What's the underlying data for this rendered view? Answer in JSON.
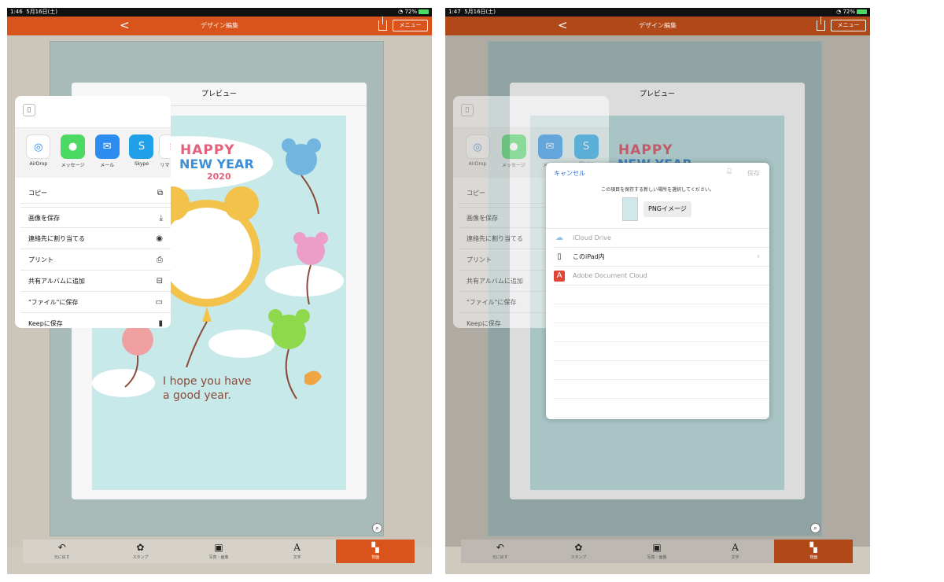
{
  "left": {
    "status": {
      "time": "1:46",
      "date": "5月16日(土)",
      "battery": "72%"
    },
    "nav": {
      "back": "<",
      "title": "デザイン編集",
      "menu": "メニュー"
    }
  },
  "right": {
    "status": {
      "time": "1:47",
      "date": "5月16日(土)",
      "battery": "72%"
    },
    "nav": {
      "back": "<",
      "title": "デザイン編集",
      "menu": "メニュー"
    }
  },
  "preview": {
    "title": "プレビュー"
  },
  "card": {
    "line1": "HAPPY",
    "line2": "NEW YEAR",
    "year": "2020",
    "message1": "I hope you have",
    "message2": "a good year."
  },
  "share_sheet": {
    "apps": [
      {
        "label": "AirDrop",
        "icon": "airdrop-icon",
        "color": "#ffffff"
      },
      {
        "label": "メッセージ",
        "icon": "messages-icon",
        "color": "#4cd964"
      },
      {
        "label": "メール",
        "icon": "mail-icon",
        "color": "#2d8cf0"
      },
      {
        "label": "Skype",
        "icon": "skype-icon",
        "color": "#1fa0e8"
      },
      {
        "label": "リマ",
        "icon": "reminders-icon",
        "color": "#ffffff"
      }
    ],
    "copy": "コピー",
    "actions": [
      {
        "label": "画像を保存",
        "icon": "save-image-icon"
      },
      {
        "label": "連絡先に割り当てる",
        "icon": "contact-icon"
      },
      {
        "label": "プリント",
        "icon": "print-icon"
      },
      {
        "label": "共有アルバムに追加",
        "icon": "shared-album-icon"
      },
      {
        "label": "\"ファイル\"に保存",
        "icon": "folder-icon"
      },
      {
        "label": "Keepに保存",
        "icon": "bookmark-icon"
      }
    ]
  },
  "picker": {
    "cancel": "キャンセル",
    "save": "保存",
    "instruction": "この項目を保存する新しい場所を選択してください。",
    "file_name": "PNGイメージ",
    "locations": [
      {
        "label": "iCloud Drive",
        "icon": "icloud-icon",
        "enabled": false
      },
      {
        "label": "このiPad内",
        "icon": "ipad-icon",
        "enabled": true
      },
      {
        "label": "Adobe Document Cloud",
        "icon": "adobe-icon",
        "enabled": false
      }
    ]
  },
  "toolbar": {
    "items": [
      {
        "label": "元に戻す",
        "icon": "undo-icon"
      },
      {
        "label": "スタンプ",
        "icon": "stamp-icon"
      },
      {
        "label": "写真・画像",
        "icon": "photo-icon"
      },
      {
        "label": "文字",
        "icon": "text-icon"
      },
      {
        "label": "背面",
        "icon": "layer-icon"
      }
    ]
  },
  "colors": {
    "accent": "#d9541c",
    "card_bg": "#c8e9ea",
    "link": "#2f6bd8"
  }
}
